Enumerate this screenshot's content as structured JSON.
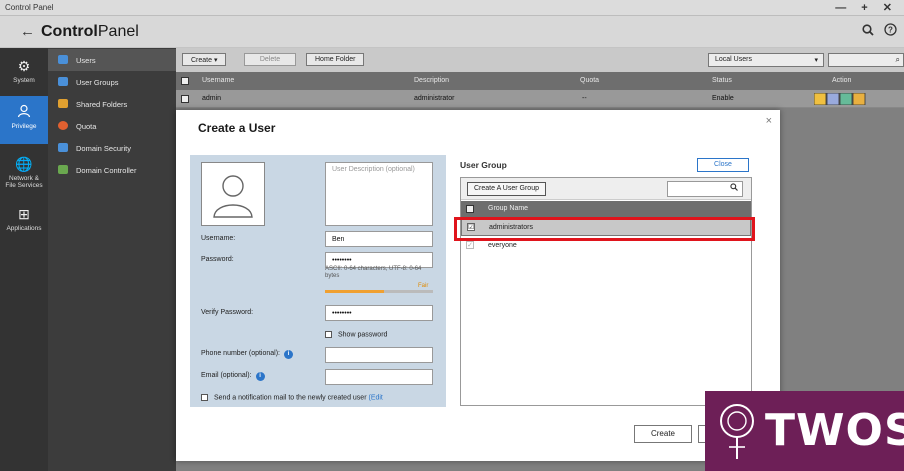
{
  "window": {
    "title": "Control Panel",
    "controls": "— + ✕"
  },
  "header": {
    "title_bold": "Control",
    "title_rest": "Panel",
    "back_icon": "←",
    "search_icon": "🔍",
    "help_icon": "?"
  },
  "rail": [
    {
      "label": "System",
      "icon": "⚙"
    },
    {
      "label": "Privilege",
      "icon": "👤"
    },
    {
      "label": "Network &",
      "label2": "File Services",
      "icon": "🌐"
    },
    {
      "label": "Applications",
      "icon": "⊞"
    }
  ],
  "sidebar": [
    {
      "label": "Users",
      "color": "#4a90d9"
    },
    {
      "label": "User Groups",
      "color": "#4a90d9"
    },
    {
      "label": "Shared Folders",
      "color": "#e0a030"
    },
    {
      "label": "Quota",
      "color": "#e06030"
    },
    {
      "label": "Domain Security",
      "color": "#4a90d9"
    },
    {
      "label": "Domain Controller",
      "color": "#6aa84f"
    }
  ],
  "toolbar": {
    "create": "Create ▾",
    "delete": "Delete",
    "home_folder": "Home Folder",
    "scope": "Local Users",
    "scope_arrow": "▾",
    "search_icon": "🔍"
  },
  "table": {
    "columns": [
      "Username",
      "Description",
      "Quota",
      "Status",
      "Action"
    ],
    "rows": [
      {
        "username": "admin",
        "description": "administrator",
        "quota": "--",
        "status": "Enable"
      }
    ]
  },
  "modal": {
    "title": "Create a User",
    "close": "×",
    "description_placeholder": "User Description (optional)",
    "username_label": "Username:",
    "username_value": "Ben",
    "password_label": "Password:",
    "password_value": "••••••••",
    "password_hint": "ASCII: 0-64 characters, UTF-8: 0-64 bytes",
    "strength_label": "Fair",
    "strength_level": 0.55,
    "verify_label": "Verify Password:",
    "verify_value": "••••••••",
    "show_password": "Show password",
    "phone_label": "Phone number (optional):",
    "email_label": "Email (optional):",
    "notify_label": "Send a notification mail to the newly created user ",
    "notify_link": "(Edit",
    "user_group_title": "User Group",
    "close_button": "Close",
    "create_group_button": "Create A User Group",
    "group_column": "Group Name",
    "groups": [
      {
        "name": "administrators",
        "checked": "☑"
      },
      {
        "name": "everyone",
        "checked": "✓"
      }
    ],
    "create_button": "Create"
  },
  "watermark": {
    "text": "TWOS"
  }
}
